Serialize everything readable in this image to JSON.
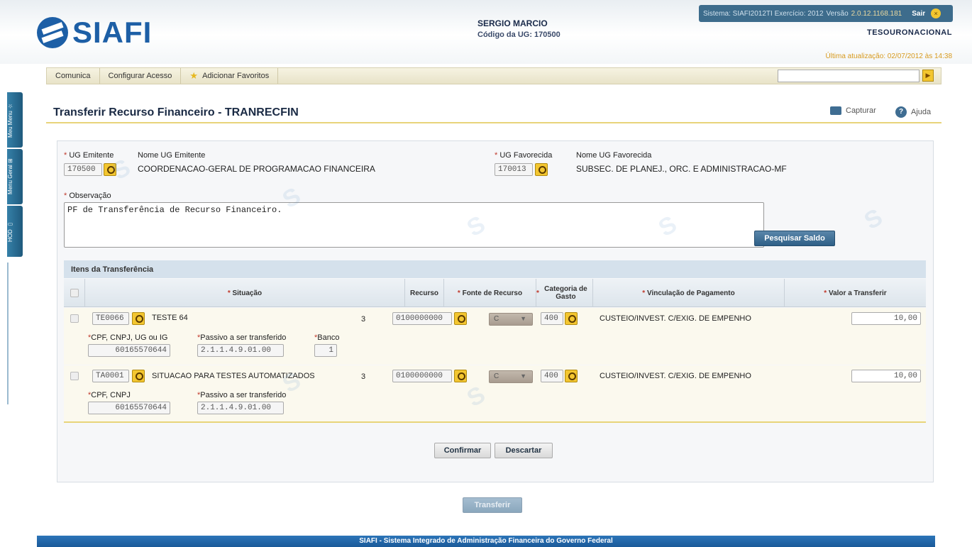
{
  "header": {
    "logo_text": "SIAFI",
    "user_name": "SERGIO MARCIO",
    "ug_code": "Código da UG: 170500",
    "system_label": "Sistema: SIAFI2012TI Exercício: 2012",
    "version_label": "Versão",
    "version_value": "2.0.12.1168.181",
    "logout": "Sair",
    "tesouro": "TESOURONACIONAL",
    "last_update": "Última atualização: 02/07/2012 às 14:38"
  },
  "menu": {
    "items": [
      {
        "label": "Comunica"
      },
      {
        "label": "Configurar Acesso"
      },
      {
        "label": "Adicionar Favoritos"
      }
    ],
    "search_value": ""
  },
  "side_tabs": [
    "Meu Menu",
    "Menu Geral",
    "HOD"
  ],
  "page": {
    "title": "Transferir Recurso Financeiro - TRANRECFIN",
    "capture": "Capturar",
    "help": "Ajuda"
  },
  "form": {
    "ug_emitente_label": "UG Emitente",
    "ug_emitente_value": "170500",
    "nome_ug_emitente_label": "Nome UG Emitente",
    "nome_ug_emitente_value": "COORDENACAO-GERAL DE PROGRAMACAO FINANCEIRA",
    "ug_favorecida_label": "UG Favorecida",
    "ug_favorecida_value": "170013",
    "nome_ug_favorecida_label": "Nome UG Favorecida",
    "nome_ug_favorecida_value": "SUBSEC. DE PLANEJ., ORC. E ADMINISTRACAO-MF",
    "observacao_label": "Observação",
    "observacao_value": "PF de Transferência de Recurso Financeiro.",
    "pesquisar_saldo": "Pesquisar Saldo"
  },
  "items": {
    "section_title": "Itens da Transferência",
    "columns": {
      "situacao": "Situação",
      "recurso": "Recurso",
      "fonte": "Fonte de Recurso",
      "categoria": "Categoria de Gasto",
      "vinculacao": "Vinculação de Pagamento",
      "valor": "Valor a Transferir"
    },
    "rows": [
      {
        "situacao_code": "TE0066",
        "situacao_desc": "TESTE 64",
        "recurso": "3",
        "fonte": "0100000000",
        "categoria": "C",
        "vinculacao_code": "400",
        "vinculacao_desc": "CUSTEIO/INVEST. C/EXIG. DE EMPENHO",
        "valor": "10,00",
        "doc_label": "CPF, CNPJ, UG ou IG",
        "doc_value": "60165570644",
        "passivo_label": "Passivo a ser transferido",
        "passivo_value": "2.1.1.4.9.01.00",
        "banco_label": "Banco",
        "banco_value": "1"
      },
      {
        "situacao_code": "TA0001",
        "situacao_desc": "SITUACAO PARA TESTES AUTOMATIZADOS",
        "recurso": "3",
        "fonte": "0100000000",
        "categoria": "C",
        "vinculacao_code": "400",
        "vinculacao_desc": "CUSTEIO/INVEST. C/EXIG. DE EMPENHO",
        "valor": "10,00",
        "doc_label": "CPF, CNPJ",
        "doc_value": "60165570644",
        "passivo_label": "Passivo a ser transferido",
        "passivo_value": "2.1.1.4.9.01.00"
      }
    ],
    "confirm": "Confirmar",
    "discard": "Descartar"
  },
  "transfer_button": "Transferir",
  "footer": "SIAFI - Sistema Integrado de Administração Financeira do Governo Federal"
}
